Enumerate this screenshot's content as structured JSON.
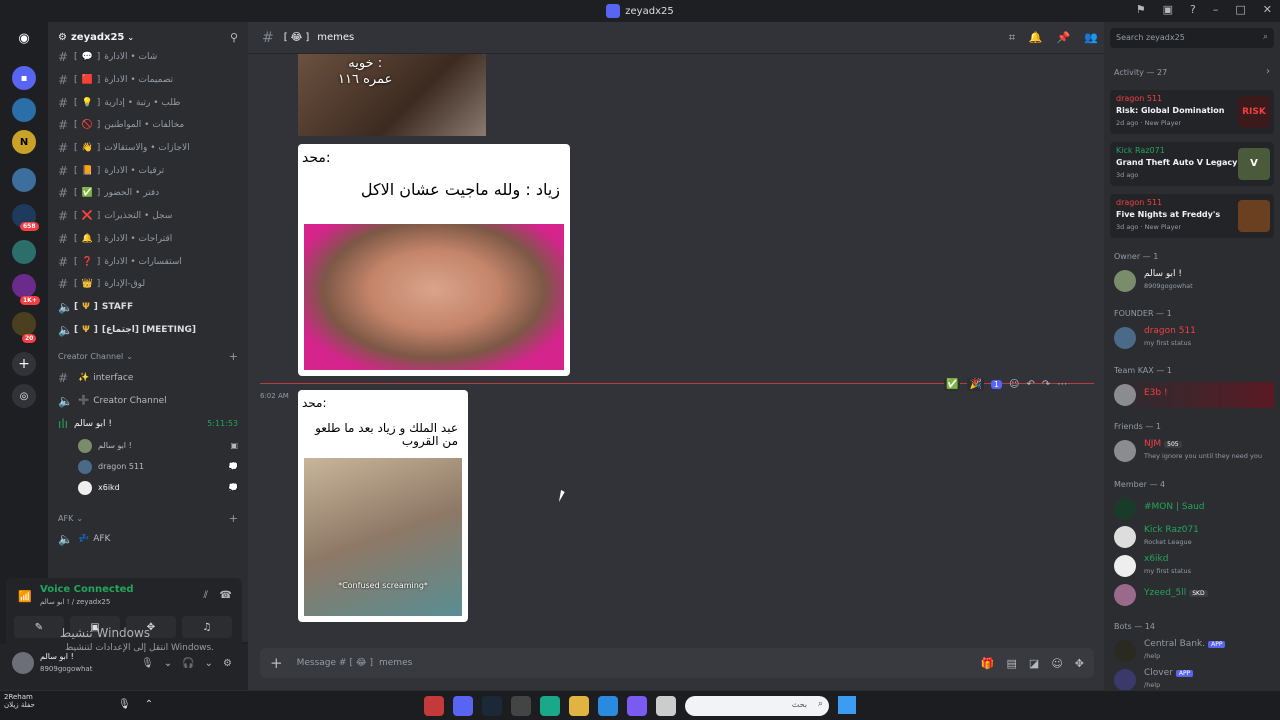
{
  "window": {
    "title": "zeyadx25"
  },
  "rail": {
    "badges": [
      "658",
      "1K+",
      "20"
    ]
  },
  "server": {
    "name": "zeyadx25"
  },
  "channels": [
    {
      "emoji": "💬",
      "label": "شات • الادارة"
    },
    {
      "emoji": "🟥",
      "label": "تصميمات • الادارة"
    },
    {
      "emoji": "💡",
      "label": "طلب • رتبة • إدارية"
    },
    {
      "emoji": "🚫",
      "label": "مخالفات • المواطنين"
    },
    {
      "emoji": "👋",
      "label": "الاجازات • والاستقالات"
    },
    {
      "emoji": "📙",
      "label": "ترقيات • الادارة"
    },
    {
      "emoji": "✅",
      "label": "دفتر • الحضور"
    },
    {
      "emoji": "❌",
      "label": "سجل • التحذيرات"
    },
    {
      "emoji": "🔔",
      "label": "اقتراحات • الادارة"
    },
    {
      "emoji": "❓",
      "label": "استفسارات • الادارة"
    },
    {
      "emoji": "👑",
      "label": "لوق-الإدارة"
    }
  ],
  "voice_channels": [
    {
      "label": "STAFF"
    },
    {
      "label": "[اجتماع] [MEETING]"
    }
  ],
  "creator_category": "Creator Channel",
  "creator_channels": [
    {
      "emoji": "✨",
      "label": "interface"
    },
    {
      "emoji": "➕",
      "label": "Creator Channel"
    }
  ],
  "active_voice": {
    "label": "ابو سالم !",
    "timer": "5:11:53"
  },
  "voice_users": [
    {
      "name": "ابو سالم !"
    },
    {
      "name": "dragon 511"
    },
    {
      "name": "x6ikd"
    }
  ],
  "afk_category": "AFK",
  "afk_channel": "AFK",
  "voice_panel": {
    "status": "Voice Connected",
    "sub": "ابو سالم ! / zeyadx25"
  },
  "user": {
    "name": "ابو سالم !",
    "status": "8909gogowhat"
  },
  "activation": {
    "line1": "تنشيط Windows",
    "line2": "انتقل إلى الإعدادات لتنشيط Windows."
  },
  "chat": {
    "channel": "memes",
    "bracket_open": "[",
    "bracket_close": "]",
    "img1_caption": "خويه :\nعمره ١١٦",
    "meme1": {
      "name": "محد:",
      "text": "زياد : ولله ماجيت عشان الاكل"
    },
    "meme2": {
      "name": "محد:",
      "text": "عبد الملك و زياد بعد ما طلعو من القروب",
      "caption": "*Confused screaming*"
    },
    "timestamp": "6:02 AM",
    "reaction_count": "1",
    "composer_placeholder": "Message #",
    "composer_channel": "memes"
  },
  "members": {
    "search_placeholder": "Search zeyadx25",
    "activity_title": "Activity — 27",
    "activities": [
      {
        "user": "dragon 511",
        "game": "Risk: Global Domination",
        "time": "2d ago",
        "tag": "New Player",
        "color": "#f23f43"
      },
      {
        "user": "Kick Raz071",
        "game": "Grand Theft Auto V Legacy",
        "time": "3d ago",
        "tag": "",
        "color": "#23a55a"
      },
      {
        "user": "dragon 511",
        "game": "Five Nights at Freddy's",
        "time": "3d ago",
        "tag": "New Player",
        "color": "#f23f43"
      }
    ],
    "groups": [
      {
        "title": "Owner — 1",
        "members": [
          {
            "name": "ابو سالم !",
            "status": "8909gogowhat",
            "color": "#f2f3f5"
          }
        ]
      },
      {
        "title": "FOUNDER — 1",
        "members": [
          {
            "name": "dragon 511",
            "status": "my first status",
            "color": "#f23f43"
          }
        ]
      },
      {
        "title": "Team KAX — 1",
        "members": [
          {
            "name": "E3b !",
            "status": "",
            "color": "#f23f43"
          }
        ]
      },
      {
        "title": "Friends — 1",
        "members": [
          {
            "name": "NJM",
            "status": "They ignore you until they need you",
            "color": "#f23f43",
            "tag": "505"
          }
        ]
      },
      {
        "title": "Member — 4",
        "members": [
          {
            "name": "#MON | Saud",
            "status": "",
            "color": "#23a55a"
          },
          {
            "name": "Kick Raz071",
            "status": "Rocket League",
            "color": "#23a55a"
          },
          {
            "name": "x6ikd",
            "status": "my first status",
            "color": "#23a55a"
          },
          {
            "name": "Yzeed_5ll",
            "status": "",
            "color": "#23a55a",
            "tag": "SKD"
          }
        ]
      },
      {
        "title": "Bots — 14",
        "members": [
          {
            "name": "Central Bank.",
            "status": "/help",
            "color": "#949ba4",
            "tag": "APP"
          },
          {
            "name": "Clover",
            "status": "/help",
            "color": "#949ba4",
            "tag": "APP"
          }
        ]
      }
    ]
  },
  "taskbar": {
    "left1": "2Reham",
    "left2": "حفلة زيلان",
    "search_placeholder": "بحث"
  }
}
